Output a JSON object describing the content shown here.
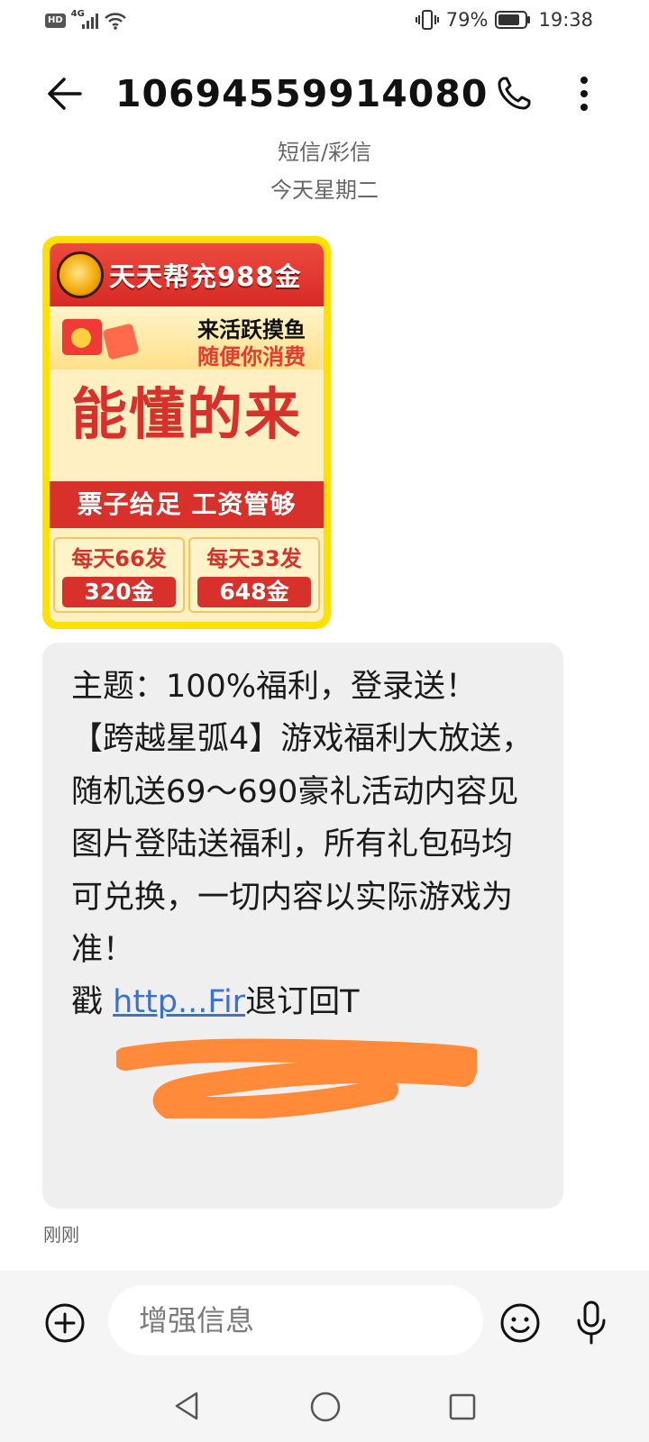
{
  "status_bar": {
    "hd": "HD",
    "network": "4G",
    "battery": "79%",
    "time": "19:38"
  },
  "header": {
    "title": "10694559914080",
    "back_icon": "arrow-left-icon",
    "call_icon": "phone-icon",
    "more_icon": "more-vertical-icon"
  },
  "conversation": {
    "type_label": "短信/彩信",
    "date_label": "今天星期二"
  },
  "mms_card": {
    "banner": "天天帮充988金",
    "promo_line1": "来活跃摸鱼",
    "promo_line2": "随便你消费",
    "headline": "能懂的来",
    "tagline": "票子给足 工资管够",
    "offers": [
      {
        "title": "每天66发",
        "amount": "320金"
      },
      {
        "title": "每天33发",
        "amount": "648金"
      }
    ],
    "colors": {
      "frame": "#ffe100",
      "red": "#d8312b",
      "cream": "#fff0c4"
    }
  },
  "message": {
    "line1": "主题：100%福利，登录送！",
    "line2": "【跨越星弧4】游戏福利大放送，随机送69～690豪礼活动内容见图片登陆送福利，所有礼包码均可兑换，一切内容以实际游戏为准！",
    "prefix": "戳 ",
    "link_text": "http...Fir",
    "suffix": "退订回T",
    "redaction_color": "#ff8a3a"
  },
  "timestamp": "刚刚",
  "composer": {
    "placeholder": "增强信息",
    "add_icon": "plus-circle-icon",
    "emoji_icon": "emoji-icon",
    "mic_icon": "microphone-icon"
  },
  "navigation": {
    "back_icon": "triangle-back-icon",
    "home_icon": "circle-home-icon",
    "recent_icon": "square-recent-icon"
  }
}
